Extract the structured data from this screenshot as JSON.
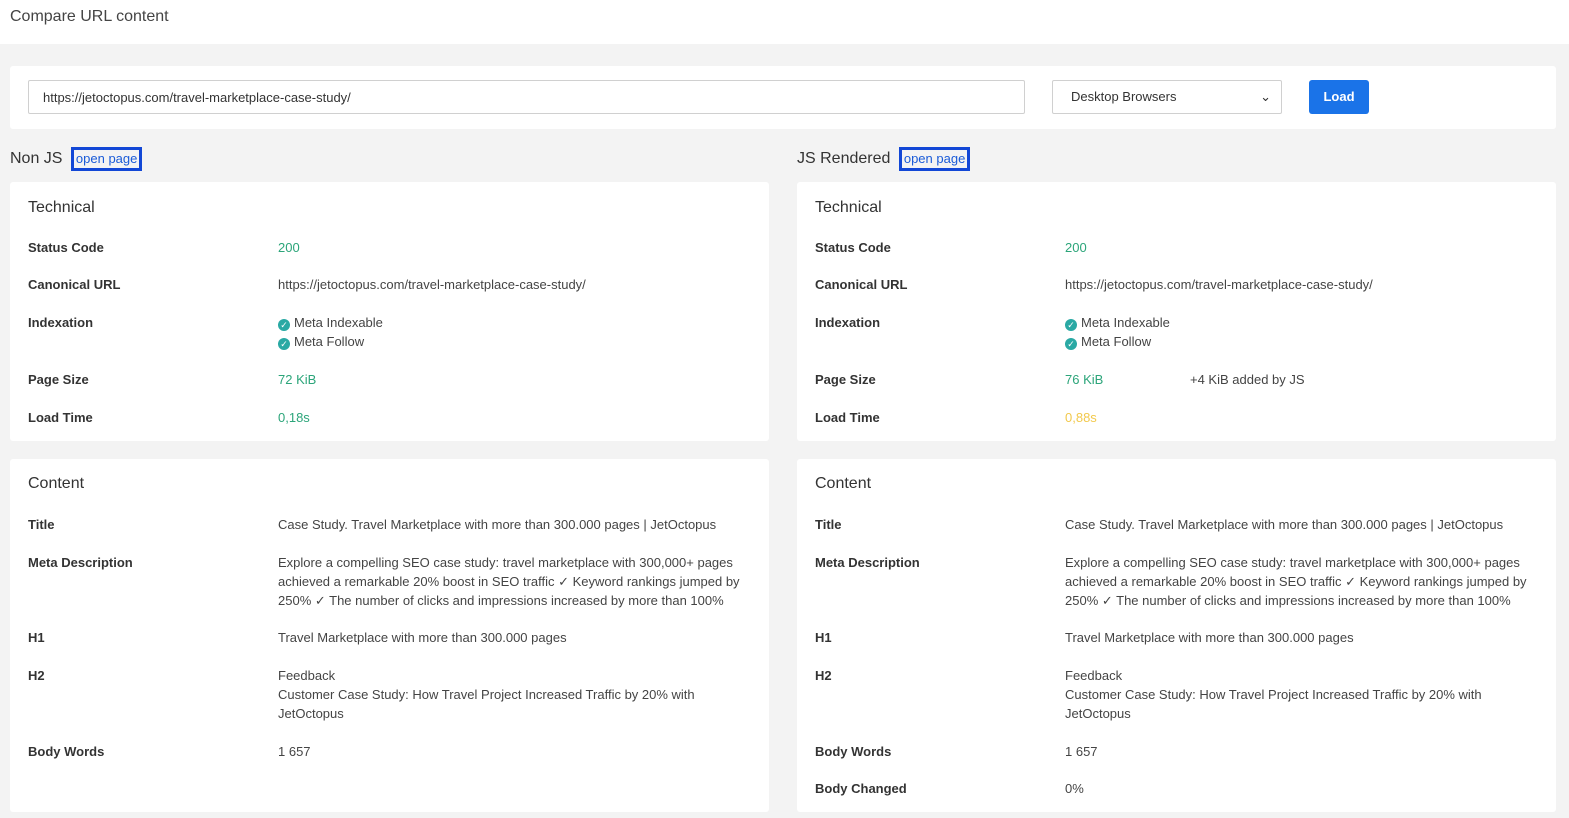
{
  "header": {
    "title": "Compare URL content"
  },
  "controls": {
    "url_value": "https://jetoctopus.com/travel-marketplace-case-study/",
    "device_selected": "Desktop Browsers",
    "load_label": "Load"
  },
  "left": {
    "heading": "Non JS",
    "open_link": "open page",
    "technical": {
      "title": "Technical",
      "status_label": "Status Code",
      "status_value": "200",
      "canonical_label": "Canonical URL",
      "canonical_value": "https://jetoctopus.com/travel-marketplace-case-study/",
      "indexation_label": "Indexation",
      "index_1": "Meta Indexable",
      "index_2": "Meta Follow",
      "size_label": "Page Size",
      "size_value": "72 KiB",
      "load_label": "Load Time",
      "load_value": "0,18s"
    },
    "content": {
      "title": "Content",
      "title_label": "Title",
      "title_value": "Case Study. Travel Marketplace with more than 300.000 pages | JetOctopus",
      "meta_label": "Meta Description",
      "meta_line1": "Explore a compelling SEO case study: travel marketplace with 300,000+ pages",
      "meta_line2": "achieved a remarkable 20% boost in SEO traffic ✓ Keyword rankings jumped by",
      "meta_line3": "250% ✓ The number of clicks and impressions increased by more than 100%",
      "h1_label": "H1",
      "h1_value": "Travel Marketplace with more than 300.000 pages",
      "h2_label": "H2",
      "h2_line1": "Feedback",
      "h2_line2": "Customer Case Study: How Travel Project Increased Traffic by 20% with",
      "h2_line3": "JetOctopus",
      "words_label": "Body Words",
      "words_value": "1 657"
    }
  },
  "right": {
    "heading": "JS Rendered",
    "open_link": "open page",
    "technical": {
      "title": "Technical",
      "status_label": "Status Code",
      "status_value": "200",
      "canonical_label": "Canonical URL",
      "canonical_value": "https://jetoctopus.com/travel-marketplace-case-study/",
      "indexation_label": "Indexation",
      "index_1": "Meta Indexable",
      "index_2": "Meta Follow",
      "size_label": "Page Size",
      "size_value": "76 KiB",
      "size_extra": "+4 KiB added by JS",
      "load_label": "Load Time",
      "load_value": "0,88s"
    },
    "content": {
      "title": "Content",
      "title_label": "Title",
      "title_value": "Case Study. Travel Marketplace with more than 300.000 pages | JetOctopus",
      "meta_label": "Meta Description",
      "meta_line1": "Explore a compelling SEO case study: travel marketplace with 300,000+ pages",
      "meta_line2": "achieved a remarkable 20% boost in SEO traffic ✓ Keyword rankings jumped by",
      "meta_line3": "250% ✓ The number of clicks and impressions increased by more than 100%",
      "h1_label": "H1",
      "h1_value": "Travel Marketplace with more than 300.000 pages",
      "h2_label": "H2",
      "h2_line1": "Feedback",
      "h2_line2": "Customer Case Study: How Travel Project Increased Traffic by 20% with",
      "h2_line3": "JetOctopus",
      "words_label": "Body Words",
      "words_value": "1 657",
      "changed_label": "Body Changed",
      "changed_value": "0%"
    }
  },
  "colors": {
    "accent": "#1a73e8",
    "ok": "#2ca57a",
    "warn": "#f2c94c",
    "check": "#2aa9a4"
  },
  "icons": {
    "indexation": "check-circle-icon",
    "select": "chevron-down-icon"
  }
}
